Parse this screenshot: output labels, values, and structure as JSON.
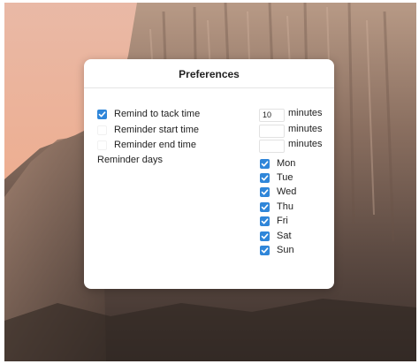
{
  "dialog": {
    "title": "Preferences"
  },
  "reminders": [
    {
      "label": "Remind to tack time",
      "checked": true,
      "value": "10",
      "unit": "minutes"
    },
    {
      "label": "Reminder start time",
      "checked": false,
      "value": "",
      "unit": "minutes"
    },
    {
      "label": "Reminder end time",
      "checked": false,
      "value": "",
      "unit": "minutes"
    }
  ],
  "reminder_days": {
    "label": "Reminder days",
    "days": [
      {
        "label": "Mon",
        "checked": true
      },
      {
        "label": "Tue",
        "checked": true
      },
      {
        "label": "Wed",
        "checked": true
      },
      {
        "label": "Thu",
        "checked": true
      },
      {
        "label": "Fri",
        "checked": true
      },
      {
        "label": "Sat",
        "checked": true
      },
      {
        "label": "Sun",
        "checked": true
      }
    ]
  },
  "icons": {
    "checkbox_checked": "checkmark-icon"
  },
  "colors": {
    "accent": "#2f86d9"
  }
}
